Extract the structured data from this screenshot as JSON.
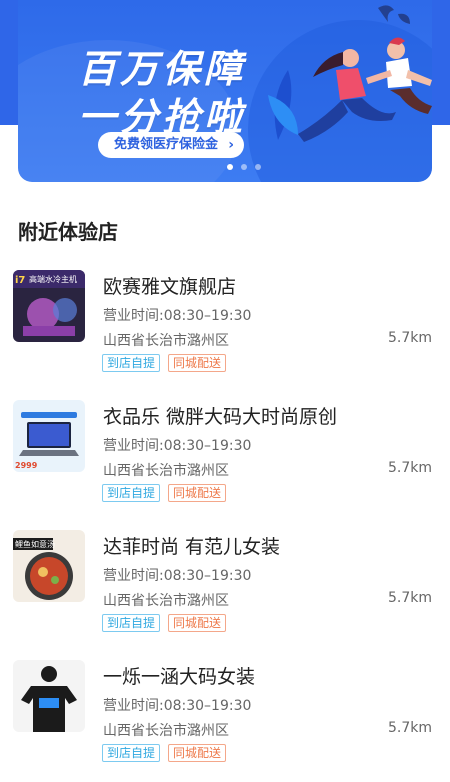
{
  "banner": {
    "headline_line1": "百万保障",
    "headline_line2": "一分抢啦",
    "cta_label": "免费领医疗保险金",
    "cta_chevron": "›",
    "page_count": 3,
    "active_page": 0,
    "colors": {
      "background": "#2f66e8",
      "accent": "#ffffff"
    }
  },
  "section": {
    "title": "附近体验店"
  },
  "stores": [
    {
      "name": "欧赛雅文旗舰店",
      "hours": "营业时间:08:30–19:30",
      "address": "山西省长治市潞州区",
      "distance": "5.7km",
      "tags": [
        "到店自提",
        "同城配送"
      ],
      "thumb_text": "高端水冷主机",
      "thumb_number": "i7"
    },
    {
      "name": "衣品乐 微胖大码大时尚原创",
      "hours": "营业时间:08:30–19:30",
      "address": "山西省长治市潞州区",
      "distance": "5.7km",
      "tags": [
        "到店自提",
        "同城配送"
      ],
      "thumb_text": "2999"
    },
    {
      "name": "达菲时尚 有范儿女装",
      "hours": "营业时间:08:30–19:30",
      "address": "山西省长治市潞州区",
      "distance": "5.7km",
      "tags": [
        "到店自提",
        "同城配送"
      ],
      "thumb_text": "鲤鱼如意汤"
    },
    {
      "name": "一烁一涵大码女装",
      "hours": "营业时间:08:30–19:30",
      "address": "山西省长治市潞州区",
      "distance": "5.7km",
      "tags": [
        "到店自提",
        "同城配送"
      ],
      "thumb_text": ""
    }
  ],
  "tag_colors": {
    "pickup": "#2fa8e0",
    "delivery": "#ee7a4b"
  }
}
